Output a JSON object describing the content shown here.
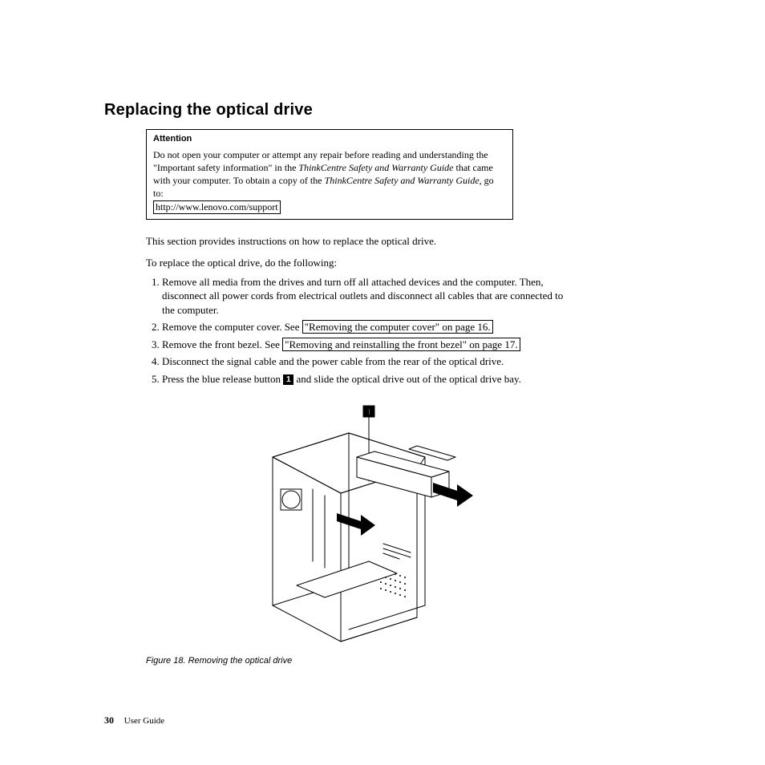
{
  "heading": "Replacing the optical drive",
  "attention": {
    "title": "Attention",
    "p1a": "Do not open your computer or attempt any repair before reading and understanding the \"Important safety information\" in the ",
    "p1_em1": "ThinkCentre Safety and Warranty Guide",
    "p1b": " that came with your computer. To obtain a copy of the ",
    "p1_em2": "ThinkCentre Safety and Warranty Guide",
    "p1c": ", go to:",
    "link": "http://www.lenovo.com/support"
  },
  "intro": "This section provides instructions on how to replace the optical drive.",
  "lead": "To replace the optical drive, do the following:",
  "steps": {
    "s1": "Remove all media from the drives and turn off all attached devices and the computer. Then, disconnect all power cords from electrical outlets and disconnect all cables that are connected to the computer.",
    "s2a": "Remove the computer cover. See ",
    "s2_link": "\"Removing the computer cover\" on page 16.",
    "s3a": "Remove the front bezel. See ",
    "s3_link": "\"Removing and reinstalling the front bezel\" on page 17.",
    "s4": "Disconnect the signal cable and the power cable from the rear of the optical drive.",
    "s5a": "Press the blue release button ",
    "s5_callout": "1",
    "s5b": " and slide the optical drive out of the optical drive bay."
  },
  "figure": {
    "callout": "1",
    "caption": "Figure 18. Removing the optical drive"
  },
  "footer": {
    "page": "30",
    "doc": "User Guide"
  }
}
